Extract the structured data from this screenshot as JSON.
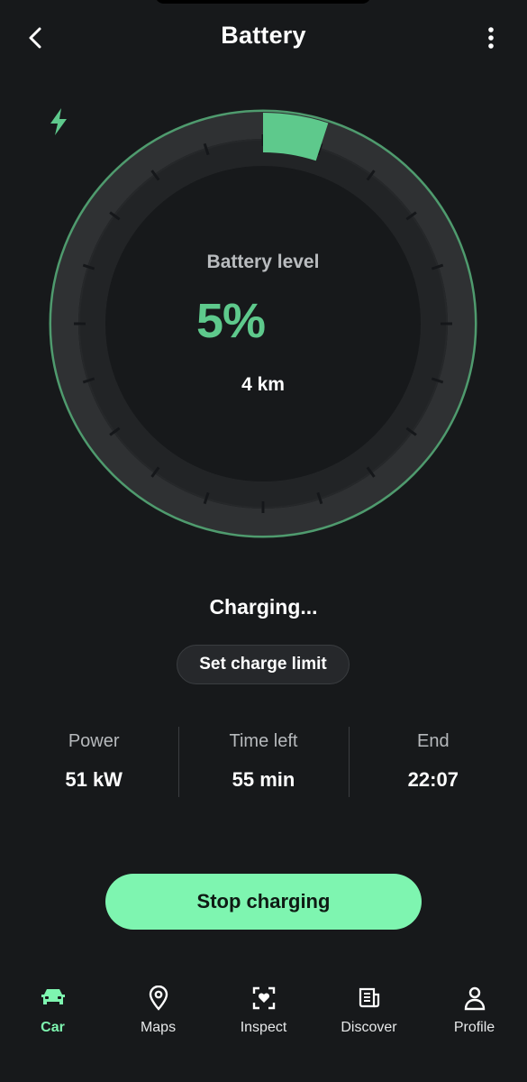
{
  "header": {
    "title": "Battery",
    "back_icon": "chevron-left-icon",
    "menu_icon": "more-vertical-icon"
  },
  "battery": {
    "label": "Battery level",
    "percent_text": "5%",
    "level": 0.05,
    "range_text": "4 km",
    "charging_icon": "bolt-icon",
    "accent_color": "#5ec98c"
  },
  "status": {
    "text": "Charging..."
  },
  "limit_button": {
    "label": "Set charge limit"
  },
  "stats": [
    {
      "label": "Power",
      "value": "51 kW"
    },
    {
      "label": "Time left",
      "value": "55 min"
    },
    {
      "label": "End",
      "value": "22:07"
    }
  ],
  "stop_button": {
    "label": "Stop charging",
    "color": "#7ef5b0"
  },
  "nav": {
    "items": [
      {
        "label": "Car",
        "icon": "car-icon",
        "active": true
      },
      {
        "label": "Maps",
        "icon": "map-pin-icon",
        "active": false
      },
      {
        "label": "Inspect",
        "icon": "inspect-icon",
        "active": false
      },
      {
        "label": "Discover",
        "icon": "news-icon",
        "active": false
      },
      {
        "label": "Profile",
        "icon": "person-icon",
        "active": false
      }
    ]
  }
}
